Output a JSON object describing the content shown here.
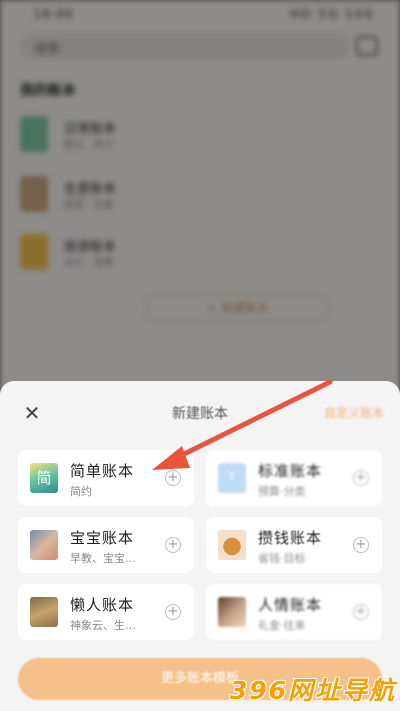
{
  "status_bar": {
    "time": "16:00",
    "right": "HD 5G 100"
  },
  "background": {
    "search_placeholder": "搜索",
    "section_title": "我的账本",
    "books": [
      {
        "name": "日常账本",
        "sub": "默认 · 共计"
      },
      {
        "name": "生意账本",
        "sub": "经营 · 记录"
      },
      {
        "name": "旅游账本",
        "sub": "出行 · 花费"
      }
    ],
    "new_book_button": "+ 新建账本"
  },
  "sheet": {
    "close_icon": "close-icon",
    "title": "新建账本",
    "header_link": "自定义账本",
    "templates": [
      {
        "name": "简单账本",
        "desc": "简约",
        "cover_text": "简",
        "cover_class": "cover-simple",
        "blurred": false
      },
      {
        "name": "标准账本",
        "desc": "预算·分类",
        "cover_text": "Y",
        "cover_class": "cover-y",
        "blurred": true
      },
      {
        "name": "宝宝账本",
        "desc": "早教、宝宝…",
        "cover_text": "",
        "cover_class": "cover-baby",
        "blurred": false
      },
      {
        "name": "攒钱账本",
        "desc": "省钱·目标",
        "cover_text": "",
        "cover_class": "cover-save",
        "blurred": true
      },
      {
        "name": "懒人账本",
        "desc": "神象云、生…",
        "cover_text": "",
        "cover_class": "cover-lazy",
        "blurred": false
      },
      {
        "name": "人情账本",
        "desc": "礼金·往来",
        "cover_text": "",
        "cover_class": "cover-gift",
        "blurred": true
      }
    ],
    "add_symbol": "+",
    "more_button": "更多账本模板"
  },
  "annotation": {
    "arrow_color": "#e8553a"
  },
  "watermark": "396网址导航",
  "colors": {
    "accent": "#f5c08a",
    "arrow": "#e8553a",
    "watermark": "#f2a200"
  }
}
